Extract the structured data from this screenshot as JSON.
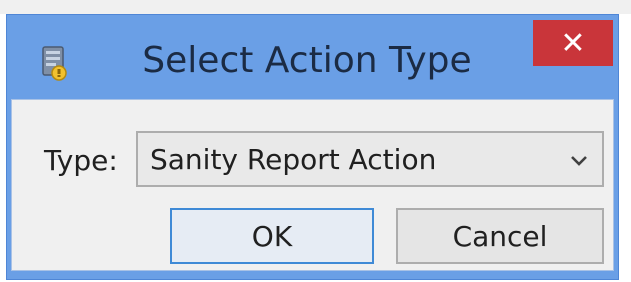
{
  "dialog": {
    "title": "Select Action Type",
    "close_icon": "close-icon",
    "app_icon": "report-app-icon",
    "colors": {
      "title_bar": "#6a9fe6",
      "close_button": "#c9353a",
      "client": "#f0f0f0",
      "default_button_border": "#3f8ad6"
    }
  },
  "form": {
    "type_label": "Type:",
    "type_value": "Sanity Report Action"
  },
  "buttons": {
    "ok_label": "OK",
    "cancel_label": "Cancel"
  }
}
